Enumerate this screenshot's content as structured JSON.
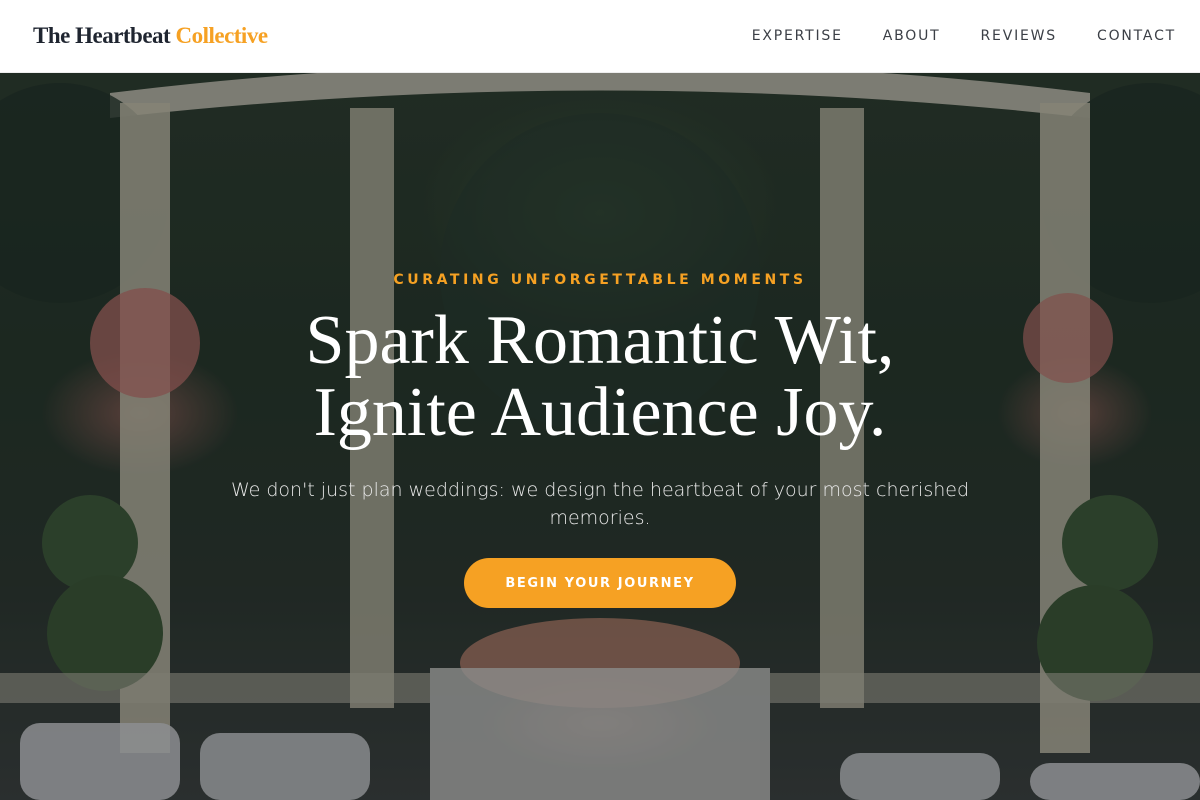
{
  "header": {
    "logo_main": "The Heartbeat",
    "logo_accent": "Collective",
    "nav": [
      {
        "label": "EXPERTISE"
      },
      {
        "label": "ABOUT"
      },
      {
        "label": "REVIEWS"
      },
      {
        "label": "CONTACT"
      }
    ]
  },
  "hero": {
    "eyebrow": "CURATING UNFORGETTABLE MOMENTS",
    "headline_line1": "Spark Romantic Wit,",
    "headline_line2": "Ignite Audience Joy.",
    "subtext": "We don't just plan weddings: we design the heartbeat of your most cherished memories.",
    "cta_label": "BEGIN YOUR JOURNEY"
  },
  "colors": {
    "accent": "#f6a123",
    "logo_text": "#1f2530",
    "nav_text": "#3b3f46",
    "headline": "#ffffff"
  }
}
